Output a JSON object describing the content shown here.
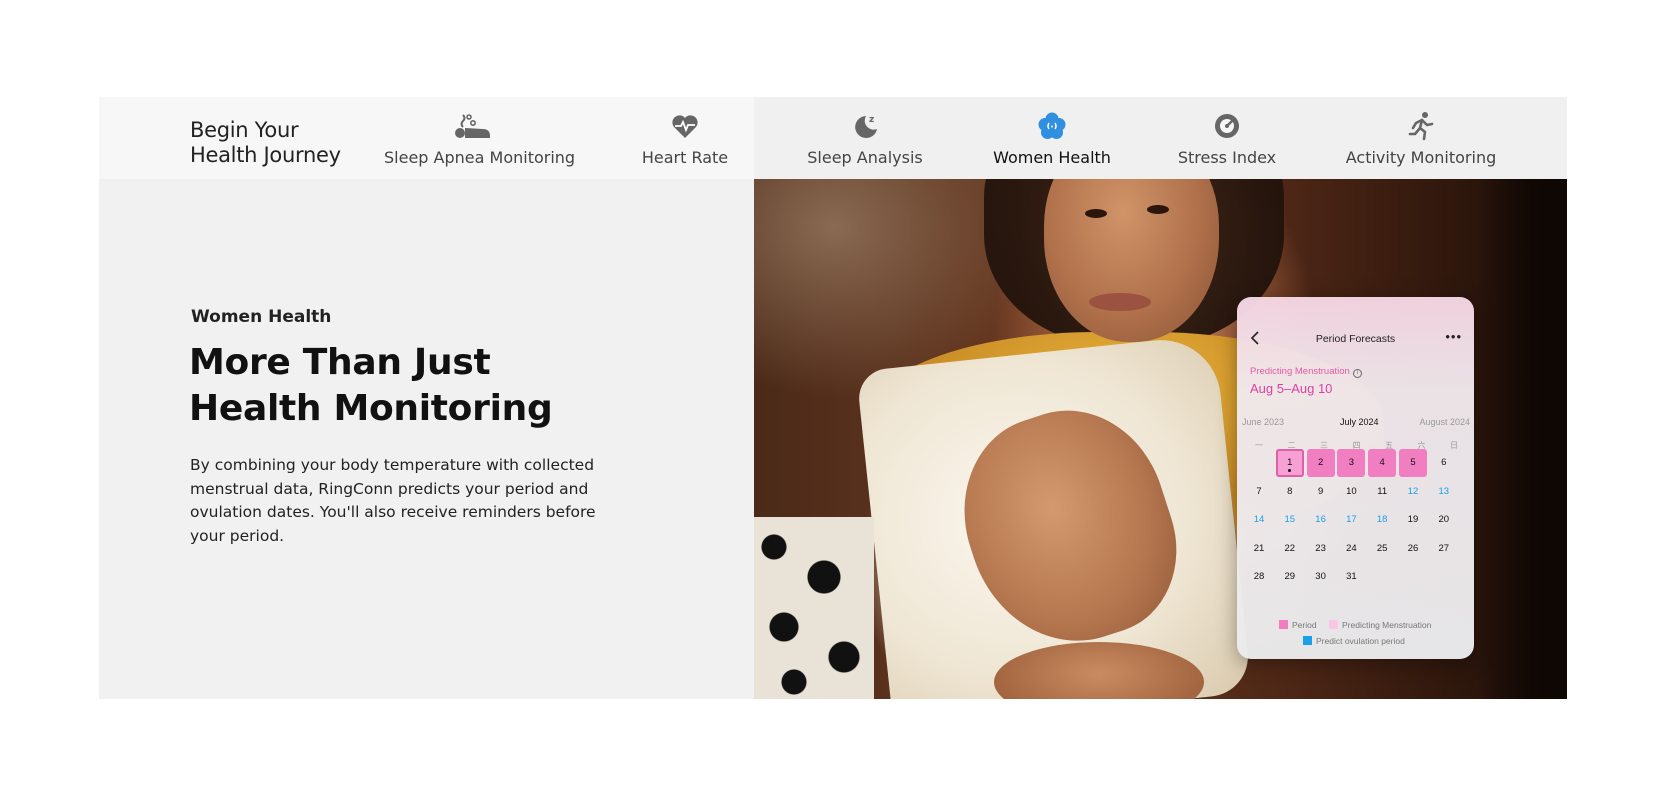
{
  "brand": {
    "line1": "Begin Your",
    "line2": "Health Journey"
  },
  "tabs": [
    {
      "label": "Sleep Apnea Monitoring",
      "icon": "sleep-apnea-icon",
      "active": false
    },
    {
      "label": "Heart Rate",
      "icon": "heart-rate-icon",
      "active": false
    },
    {
      "label": "Sleep Analysis",
      "icon": "moon-icon",
      "active": false
    },
    {
      "label": "Women Health",
      "icon": "flower-icon",
      "active": true
    },
    {
      "label": "Stress Index",
      "icon": "gauge-icon",
      "active": false
    },
    {
      "label": "Activity Monitoring",
      "icon": "running-icon",
      "active": false
    }
  ],
  "content": {
    "eyebrow": "Women Health",
    "headline_line1": "More Than Just",
    "headline_line2": "Health Monitoring",
    "body": "By combining your body temperature with collected menstrual data, RingConn predicts your period and ovulation dates. You'll also receive reminders before your period."
  },
  "colors": {
    "accent_active": "#2f8fe0",
    "period": "#f27ec2",
    "predicting": "#f9c6e4",
    "ovulation": "#1aa0e8"
  },
  "card": {
    "title": "Period Forecasts",
    "more": "•••",
    "predicting_label": "Predicting Menstruation",
    "info_icon": "i",
    "predicted_dates": "Aug 5–Aug 10",
    "months": {
      "prev": "June 2023",
      "current": "July 2024",
      "next": "August 2024"
    },
    "weekdays": [
      "一",
      "二",
      "三",
      "四",
      "五",
      "六",
      "日"
    ],
    "weeks": [
      [
        "",
        "1",
        "2",
        "3",
        "4",
        "5",
        "6"
      ],
      [
        "7",
        "8",
        "9",
        "10",
        "11",
        "12",
        "13"
      ],
      [
        "14",
        "15",
        "16",
        "17",
        "18",
        "19",
        "20"
      ],
      [
        "21",
        "22",
        "23",
        "24",
        "25",
        "26",
        "27"
      ],
      [
        "28",
        "29",
        "30",
        "31",
        "",
        "",
        ""
      ]
    ],
    "period_days": [
      "1",
      "2",
      "3",
      "4",
      "5"
    ],
    "ovulation_days": [
      "12",
      "13",
      "14",
      "15",
      "16",
      "17",
      "18"
    ],
    "today": "1",
    "legend": {
      "period": "Period",
      "predicting": "Predicting Menstruation",
      "ovulation": "Predict ovulation period"
    }
  }
}
